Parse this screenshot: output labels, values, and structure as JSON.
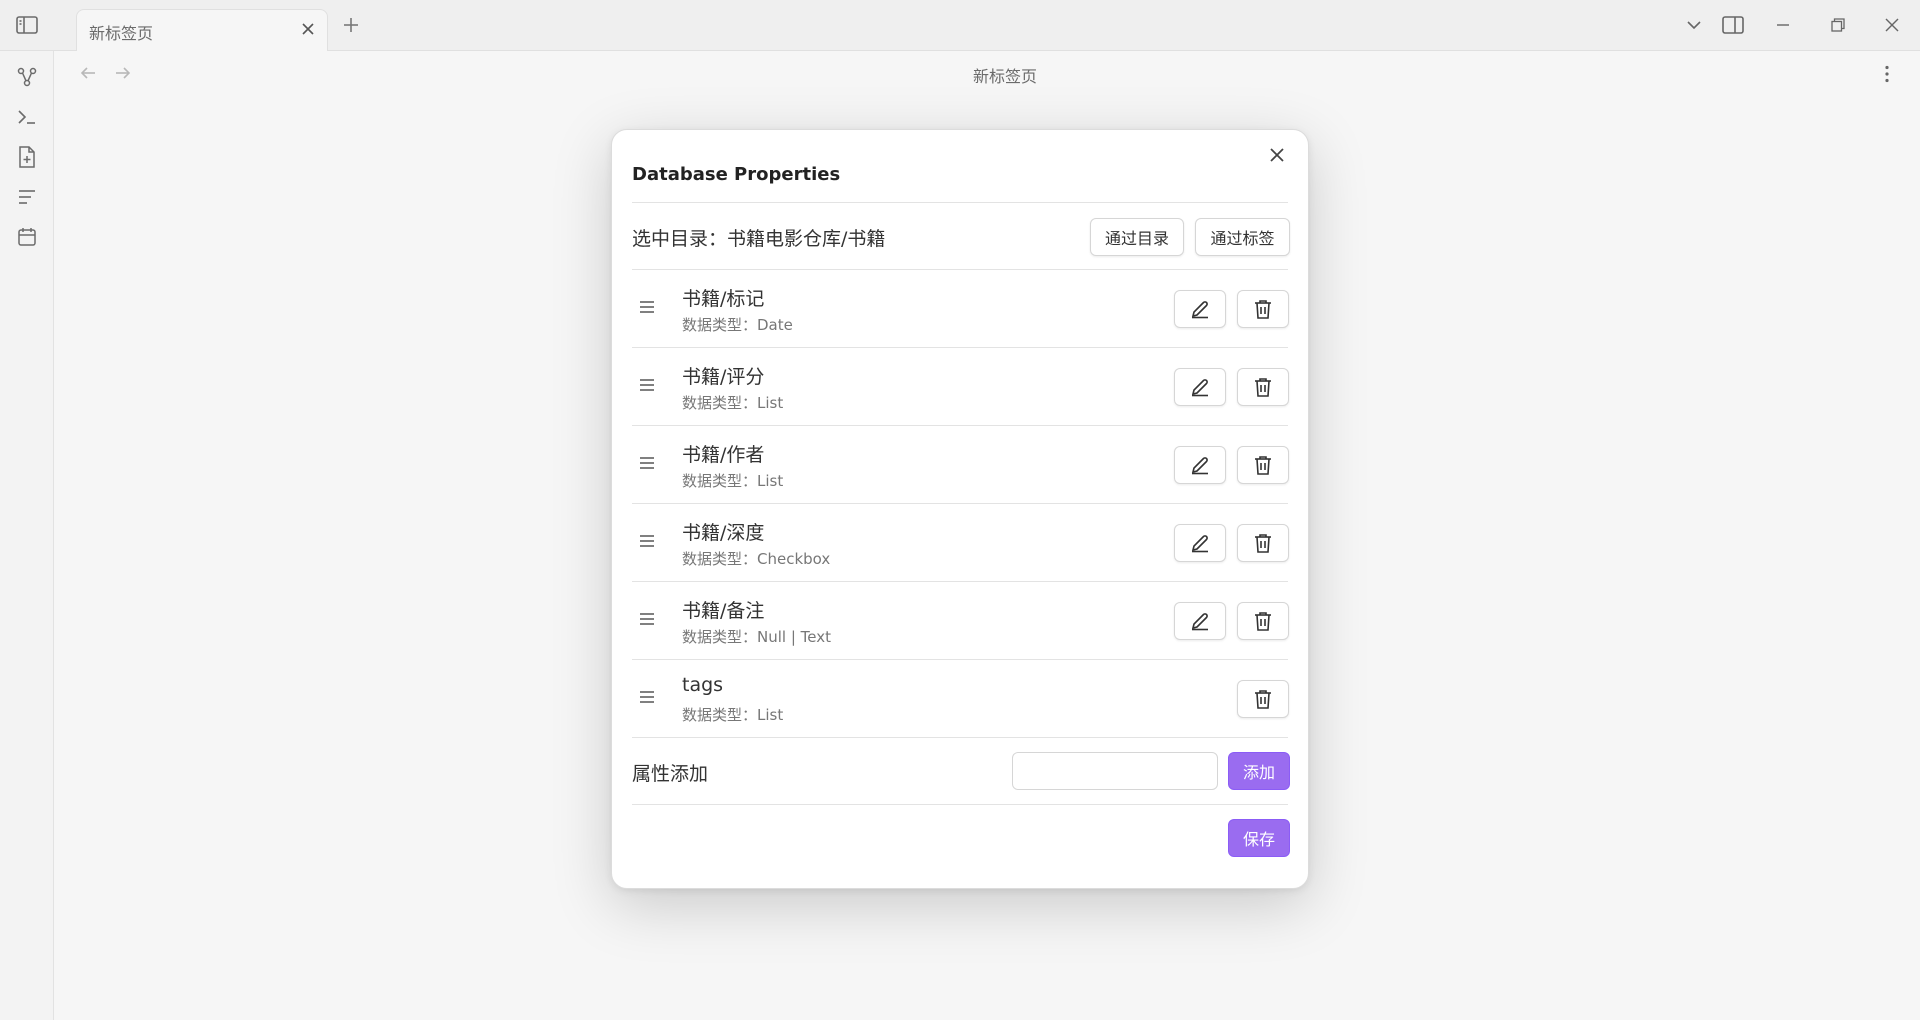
{
  "tab": {
    "title": "新标签页"
  },
  "header": {
    "title": "新标签页"
  },
  "modal": {
    "title": "Database Properties",
    "directory_label": "选中目录：书籍电影仓库/书籍",
    "by_directory_button": "通过目录",
    "by_tag_button": "通过标签",
    "properties": [
      {
        "name": "书籍/标记",
        "type": "数据类型：Date",
        "editable": true
      },
      {
        "name": "书籍/评分",
        "type": "数据类型：List",
        "editable": true
      },
      {
        "name": "书籍/作者",
        "type": "数据类型：List",
        "editable": true
      },
      {
        "name": "书籍/深度",
        "type": "数据类型：Checkbox",
        "editable": true
      },
      {
        "name": "书籍/备注",
        "type": "数据类型：Null | Text",
        "editable": true
      },
      {
        "name": "tags",
        "type": "数据类型：List",
        "editable": false
      }
    ],
    "add_label": "属性添加",
    "add_input_value": "",
    "add_button": "添加",
    "save_button": "保存"
  },
  "colors": {
    "accent": "#9a6cf0",
    "background": "#f6f6f6",
    "modal": "#ffffff"
  },
  "icons": {
    "titlebar": [
      "sidebar-toggle-icon",
      "close-icon",
      "plus-icon",
      "chevron-down-icon",
      "split-view-icon",
      "minimize-icon",
      "restore-icon",
      "close-icon"
    ],
    "ribbon": [
      "graph-icon",
      "terminal-icon",
      "new-file-icon",
      "outline-icon",
      "calendar-icon"
    ],
    "rows": [
      "drag-handle-icon",
      "pencil-icon",
      "trash-icon"
    ]
  }
}
